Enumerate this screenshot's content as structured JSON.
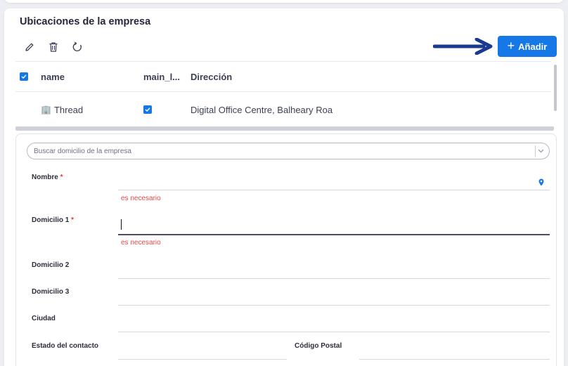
{
  "card": {
    "title": "Ubicaciones de la empresa"
  },
  "toolbar": {
    "add_label": "Añadir",
    "add_plus": "+"
  },
  "grid": {
    "columns": [
      "name",
      "main_l...",
      "Dirección"
    ],
    "rows": [
      {
        "name": "Thread",
        "main": true,
        "address": "Digital Office Centre, Balheary Roa"
      }
    ]
  },
  "form": {
    "search_placeholder": "Buscar domicilio de la empresa",
    "required_mark": "*",
    "fields": {
      "nombre": "Nombre",
      "domicilio1": "Domicilio 1",
      "domicilio2": "Domicilio 2",
      "domicilio3": "Domicilio 3",
      "ciudad": "Ciudad",
      "estado": "Estado del contacto",
      "codigo_postal": "Código Postal"
    },
    "error_required": "es necesario"
  },
  "colors": {
    "primary": "#1677e6",
    "error": "#e04b4b",
    "arrow": "#1a3a8f"
  }
}
